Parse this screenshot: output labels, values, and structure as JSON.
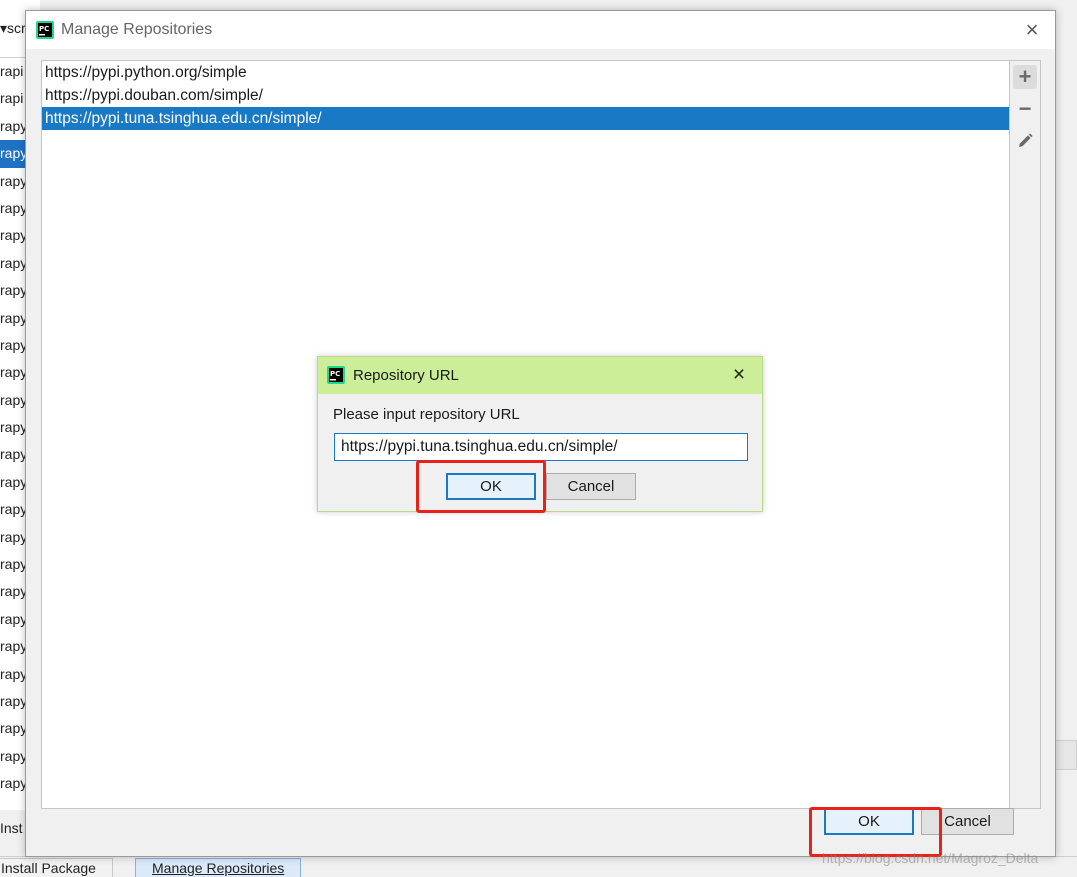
{
  "background": {
    "crumb": "scr",
    "list_rows": [
      "rapi",
      "rapi",
      "rapy",
      "rapy",
      "rapy",
      "rapy",
      "rapy",
      "rapy",
      "rapy",
      "rapy",
      "rapy",
      "rapy",
      "rapy",
      "rapy",
      "rapy",
      "rapy",
      "rapy",
      "rapy",
      "rapy",
      "rapy",
      "rapy",
      "rapy",
      "rapy",
      "rapy",
      "rapy",
      "rapy",
      "rapy"
    ],
    "selected_row": 3,
    "install_text": "Inst",
    "tabs": {
      "install": "Install Package",
      "manage": "Manage Repositories"
    }
  },
  "main_dialog": {
    "title": "Manage Repositories",
    "close_glyph": "×",
    "repositories": [
      "https://pypi.python.org/simple",
      "https://pypi.douban.com/simple/",
      "https://pypi.tuna.tsinghua.edu.cn/simple/"
    ],
    "selected_index": 2,
    "toolbar": {
      "add": "+",
      "remove": "−",
      "edit_icon": "pencil-icon"
    },
    "ok_label": "OK",
    "cancel_label": "Cancel"
  },
  "sub_dialog": {
    "title": "Repository URL",
    "close_glyph": "×",
    "prompt": "Please input repository URL",
    "input_value": "https://pypi.tuna.tsinghua.edu.cn/simple/",
    "ok_label": "OK",
    "cancel_label": "Cancel"
  },
  "watermark": "https://blog.csdn.net/Magroz_Delta",
  "colors": {
    "selection": "#1a79c4",
    "sub_title_bg": "#ccee99",
    "highlight": "#e8221b"
  }
}
